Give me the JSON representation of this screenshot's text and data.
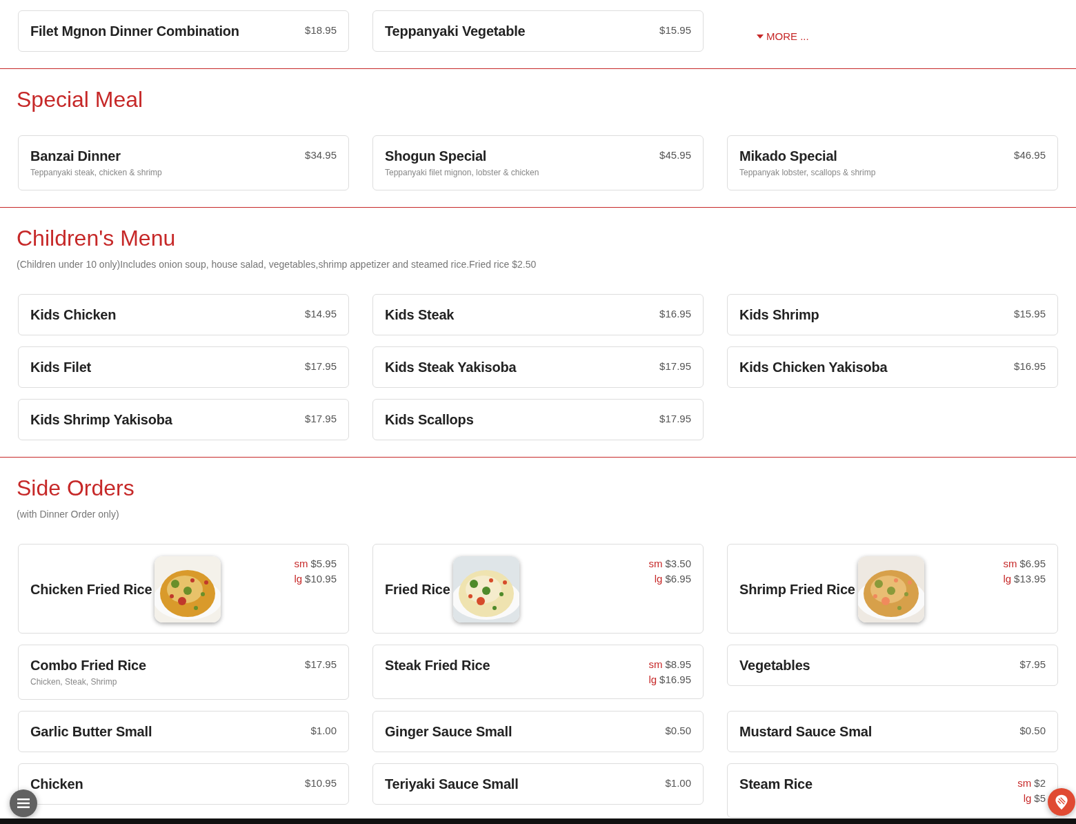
{
  "sections": [
    {
      "items": [
        {
          "name": "Filet Mgnon Dinner Combination",
          "prices": [
            {
              "amount": "$18.95"
            }
          ]
        },
        {
          "name": "Teppanyaki Vegetable",
          "prices": [
            {
              "amount": "$15.95"
            }
          ]
        }
      ],
      "more": "MORE ..."
    },
    {
      "title": "Special Meal",
      "items": [
        {
          "name": "Banzai Dinner",
          "desc": "Teppanyaki steak, chicken & shrimp",
          "prices": [
            {
              "amount": "$34.95"
            }
          ]
        },
        {
          "name": "Shogun Special",
          "desc": "Teppanyaki filet mignon, lobster & chicken",
          "prices": [
            {
              "amount": "$45.95"
            }
          ]
        },
        {
          "name": "Mikado Special",
          "desc": "Teppanyak lobster, scallops & shrimp",
          "prices": [
            {
              "amount": "$46.95"
            }
          ]
        }
      ]
    },
    {
      "title": "Children's Menu",
      "note": "(Children under 10 only)Includes onion soup, house salad, vegetables,shrimp appetizer and steamed rice.Fried rice $2.50",
      "items": [
        {
          "name": "Kids Chicken",
          "prices": [
            {
              "amount": "$14.95"
            }
          ]
        },
        {
          "name": "Kids Steak",
          "prices": [
            {
              "amount": "$16.95"
            }
          ]
        },
        {
          "name": "Kids Shrimp",
          "prices": [
            {
              "amount": "$15.95"
            }
          ]
        },
        {
          "name": "Kids Filet",
          "prices": [
            {
              "amount": "$17.95"
            }
          ]
        },
        {
          "name": "Kids Steak Yakisoba",
          "prices": [
            {
              "amount": "$17.95"
            }
          ]
        },
        {
          "name": "Kids Chicken Yakisoba",
          "prices": [
            {
              "amount": "$16.95"
            }
          ]
        },
        {
          "name": "Kids Shrimp Yakisoba",
          "prices": [
            {
              "amount": "$17.95"
            }
          ]
        },
        {
          "name": "Kids Scallops",
          "prices": [
            {
              "amount": "$17.95"
            }
          ]
        }
      ]
    },
    {
      "title": "Side Orders",
      "note": "(with Dinner Order only)",
      "items": [
        {
          "name": "Chicken Fried Rice",
          "image": {
            "kind": "picture"
          },
          "prices": [
            {
              "size": "sm",
              "amount": "$5.95"
            },
            {
              "size": "lg",
              "amount": "$10.95"
            }
          ]
        },
        {
          "name": "Fried Rice",
          "image": {
            "kind": "picture"
          },
          "prices": [
            {
              "size": "sm",
              "amount": "$3.50"
            },
            {
              "size": "lg",
              "amount": "$6.95"
            }
          ]
        },
        {
          "name": "Shrimp Fried Rice",
          "image": {
            "kind": "picture"
          },
          "prices": [
            {
              "size": "sm",
              "amount": "$6.95"
            },
            {
              "size": "lg",
              "amount": "$13.95"
            }
          ]
        },
        {
          "name": "Combo Fried Rice",
          "desc": "Chicken, Steak, Shrimp",
          "prices": [
            {
              "amount": "$17.95"
            }
          ]
        },
        {
          "name": "Steak Fried Rice",
          "prices": [
            {
              "size": "sm",
              "amount": "$8.95"
            },
            {
              "size": "lg",
              "amount": "$16.95"
            }
          ]
        },
        {
          "name": "Vegetables",
          "prices": [
            {
              "amount": "$7.95"
            }
          ]
        },
        {
          "name": "Garlic Butter Small",
          "prices": [
            {
              "amount": "$1.00"
            }
          ]
        },
        {
          "name": "Ginger Sauce Small",
          "prices": [
            {
              "amount": "$0.50"
            }
          ]
        },
        {
          "name": "Mustard Sauce Smal",
          "prices": [
            {
              "amount": "$0.50"
            }
          ]
        },
        {
          "name": "Chicken",
          "prices": [
            {
              "amount": "$10.95"
            }
          ]
        },
        {
          "name": "Teriyaki Sauce Small",
          "prices": [
            {
              "amount": "$1.00"
            }
          ]
        },
        {
          "name": "Steam Rice",
          "prices": [
            {
              "size": "sm",
              "amount": "$2"
            },
            {
              "size": "lg",
              "amount": "$5"
            }
          ]
        }
      ]
    }
  ]
}
